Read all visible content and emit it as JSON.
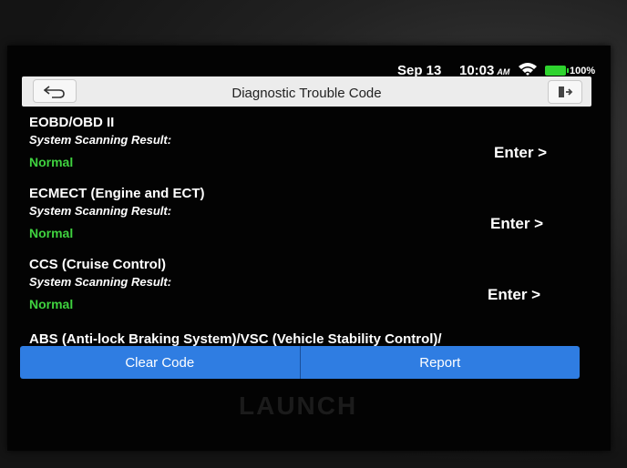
{
  "statusbar": {
    "date": "Sep 13",
    "time": "10:03",
    "ampm": "AM",
    "battery": "100%"
  },
  "header": {
    "title": "Diagnostic Trouble Code"
  },
  "systems": [
    {
      "name": "EOBD/OBD II",
      "label": "System Scanning Result:",
      "status": "Normal",
      "action": "Enter >"
    },
    {
      "name": "ECMECT (Engine and ECT)",
      "label": "System Scanning Result:",
      "status": "Normal",
      "action": "Enter >"
    },
    {
      "name": "CCS (Cruise Control)",
      "label": "System Scanning Result:",
      "status": "Normal",
      "action": "Enter >"
    }
  ],
  "partial_item": {
    "name": "ABS (Anti-lock Braking System)/VSC (Vehicle Stability Control)/"
  },
  "actions": {
    "clear": "Clear Code",
    "report": "Report"
  },
  "device": {
    "brand": "LAUNCH"
  },
  "colors": {
    "accent": "#2f7de2",
    "status_ok": "#3fd23f"
  }
}
